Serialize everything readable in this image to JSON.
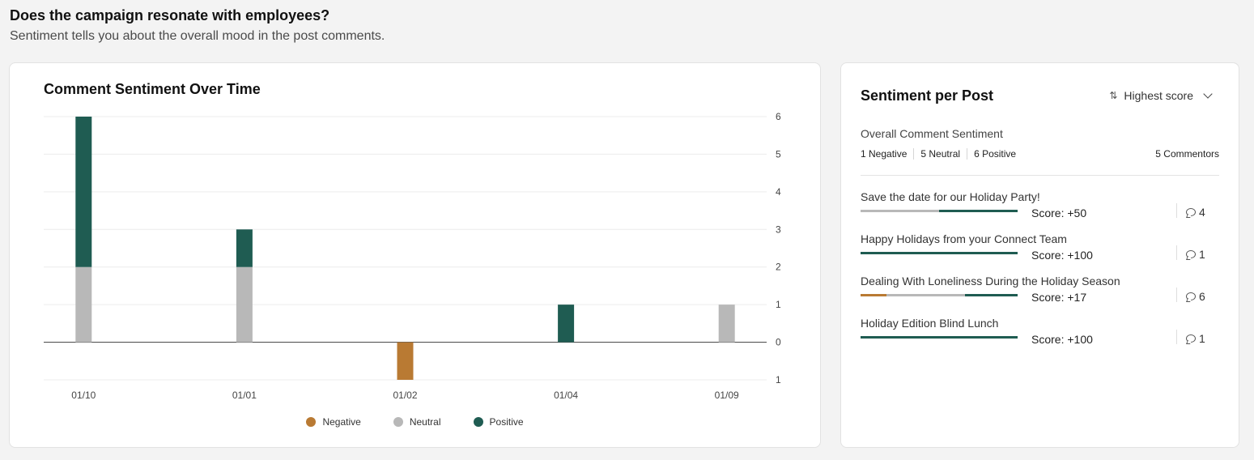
{
  "header": {
    "title": "Does the campaign resonate with employees?",
    "subtitle": "Sentiment tells you about the overall mood in the post comments."
  },
  "colors": {
    "negative": "#b97a33",
    "neutral": "#b8b8b8",
    "positive": "#1f5c52"
  },
  "chart_data": {
    "type": "bar",
    "stacked": true,
    "title": "Comment Sentiment Over Time",
    "categories": [
      "01/10",
      "01/01",
      "01/02",
      "01/04",
      "01/09"
    ],
    "series": [
      {
        "name": "Negative",
        "values": [
          0,
          0,
          -1,
          0,
          0
        ]
      },
      {
        "name": "Neutral",
        "values": [
          2,
          2,
          0,
          0,
          1
        ]
      },
      {
        "name": "Positive",
        "values": [
          4,
          1,
          0,
          1,
          0
        ]
      }
    ],
    "ylim": [
      -1,
      6
    ],
    "yticks": [
      6,
      5,
      4,
      3,
      2,
      1,
      0,
      1
    ],
    "grid": true,
    "yaxis_position": "right",
    "legend": "bottom"
  },
  "legend": {
    "negative": "Negative",
    "neutral": "Neutral",
    "positive": "Positive"
  },
  "panel": {
    "title": "Sentiment per Post",
    "sort_label": "Highest score",
    "overall_label": "Overall Comment Sentiment",
    "counts": {
      "negative": "1 Negative",
      "neutral": "5 Neutral",
      "positive": "6 Positive"
    },
    "commentors": "5 Commentors",
    "posts": [
      {
        "title": "Save the date for our Holiday Party!",
        "score": "Score: +50",
        "comments": "4",
        "split": {
          "negative": 0,
          "neutral": 0.5,
          "positive": 0.5
        }
      },
      {
        "title": "Happy Holidays from your Connect Team",
        "score": "Score: +100",
        "comments": "1",
        "split": {
          "negative": 0,
          "neutral": 0,
          "positive": 1
        }
      },
      {
        "title": "Dealing With Loneliness During the Holiday Season",
        "score": "Score: +17",
        "comments": "6",
        "split": {
          "negative": 0.167,
          "neutral": 0.5,
          "positive": 0.333
        }
      },
      {
        "title": "Holiday Edition Blind Lunch",
        "score": "Score: +100",
        "comments": "1",
        "split": {
          "negative": 0,
          "neutral": 0,
          "positive": 1
        }
      }
    ]
  }
}
